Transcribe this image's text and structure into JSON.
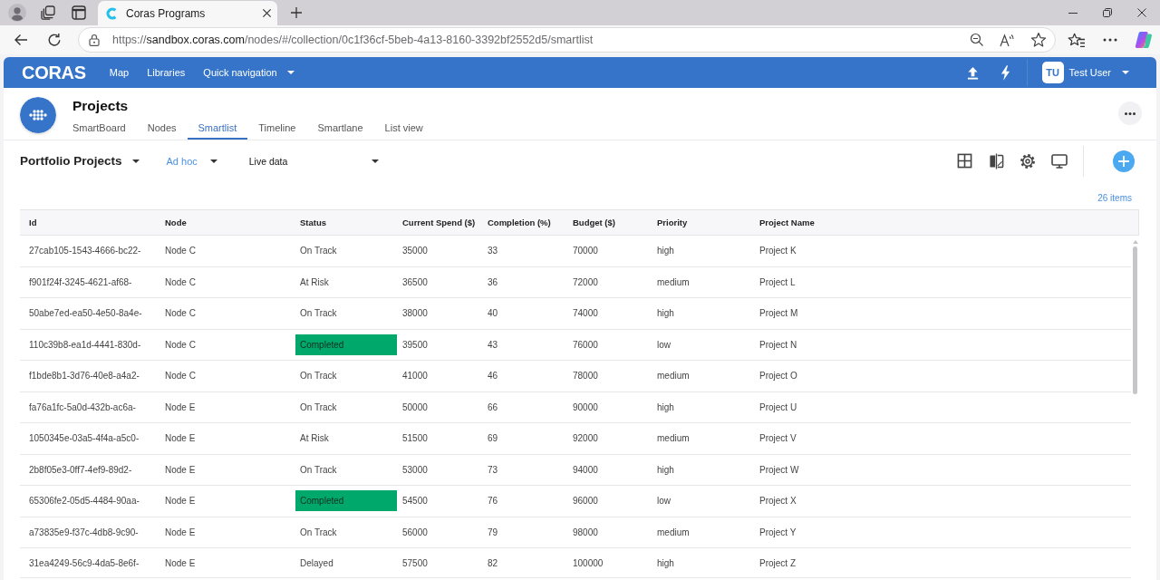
{
  "browser": {
    "tabs": [
      {
        "title": "Coras Programs",
        "selected": true
      }
    ],
    "url": {
      "scheme": "https://",
      "host": "sandbox.coras.com",
      "path": "/nodes/#/collection/0c1f36cf-5beb-4a13-8160-3392bf2552d5/smartlist"
    }
  },
  "app_header": {
    "logo": "CORAS",
    "nav": [
      {
        "label": "Map",
        "kind": "link"
      },
      {
        "label": "Libraries",
        "kind": "link"
      },
      {
        "label": "Quick navigation",
        "kind": "dropdown"
      }
    ],
    "user": {
      "initials": "TU",
      "name": "Test User"
    }
  },
  "page": {
    "title": "Projects",
    "tabs": [
      {
        "label": "SmartBoard",
        "selected": false
      },
      {
        "label": "Nodes",
        "selected": false
      },
      {
        "label": "Smartlist",
        "selected": true
      },
      {
        "label": "Timeline",
        "selected": false
      },
      {
        "label": "Smartlane",
        "selected": false
      },
      {
        "label": "List view",
        "selected": false
      }
    ]
  },
  "toolbar": {
    "view": "Portfolio Projects",
    "mode": "Ad hoc",
    "source": "Live data"
  },
  "item_count": "26 items",
  "table": {
    "columns": [
      "Id",
      "Node",
      "Status",
      "Current Spend ($)",
      "Completion (%)",
      "Budget ($)",
      "Priority",
      "Project Name"
    ],
    "rows": [
      {
        "id": "27cab105-1543-4666-bc22-",
        "node": "Node C",
        "status": "On Track",
        "current_spend": "35000",
        "completion": "33",
        "budget": "70000",
        "priority": "high",
        "project_name": "Project K",
        "status_highlighted": false
      },
      {
        "id": "f901f24f-3245-4621-af68-",
        "node": "Node C",
        "status": "At Risk",
        "current_spend": "36500",
        "completion": "36",
        "budget": "72000",
        "priority": "medium",
        "project_name": "Project L",
        "status_highlighted": false
      },
      {
        "id": "50abe7ed-ea50-4e50-8a4e-",
        "node": "Node C",
        "status": "On Track",
        "current_spend": "38000",
        "completion": "40",
        "budget": "74000",
        "priority": "high",
        "project_name": "Project M",
        "status_highlighted": false
      },
      {
        "id": "110c39b8-ea1d-4441-830d-",
        "node": "Node C",
        "status": "Completed",
        "current_spend": "39500",
        "completion": "43",
        "budget": "76000",
        "priority": "low",
        "project_name": "Project N",
        "status_highlighted": true
      },
      {
        "id": "f1bde8b1-3d76-40e8-a4a2-",
        "node": "Node C",
        "status": "On Track",
        "current_spend": "41000",
        "completion": "46",
        "budget": "78000",
        "priority": "medium",
        "project_name": "Project O",
        "status_highlighted": false
      },
      {
        "id": "fa76a1fc-5a0d-432b-ac6a-",
        "node": "Node E",
        "status": "On Track",
        "current_spend": "50000",
        "completion": "66",
        "budget": "90000",
        "priority": "high",
        "project_name": "Project U",
        "status_highlighted": false
      },
      {
        "id": "1050345e-03a5-4f4a-a5c0-",
        "node": "Node E",
        "status": "At Risk",
        "current_spend": "51500",
        "completion": "69",
        "budget": "92000",
        "priority": "medium",
        "project_name": "Project V",
        "status_highlighted": false
      },
      {
        "id": "2b8f05e3-0ff7-4ef9-89d2-",
        "node": "Node E",
        "status": "On Track",
        "current_spend": "53000",
        "completion": "73",
        "budget": "94000",
        "priority": "high",
        "project_name": "Project W",
        "status_highlighted": false
      },
      {
        "id": "65306fe2-05d5-4484-90aa-",
        "node": "Node E",
        "status": "Completed",
        "current_spend": "54500",
        "completion": "76",
        "budget": "96000",
        "priority": "low",
        "project_name": "Project X",
        "status_highlighted": true
      },
      {
        "id": "a73835e9-f37c-4db8-9c90-",
        "node": "Node E",
        "status": "On Track",
        "current_spend": "56000",
        "completion": "79",
        "budget": "98000",
        "priority": "medium",
        "project_name": "Project Y",
        "status_highlighted": false
      },
      {
        "id": "31ea4249-56c9-4da5-8e6f-",
        "node": "Node E",
        "status": "Delayed",
        "current_spend": "57500",
        "completion": "82",
        "budget": "100000",
        "priority": "high",
        "project_name": "Project Z",
        "status_highlighted": false
      }
    ]
  }
}
